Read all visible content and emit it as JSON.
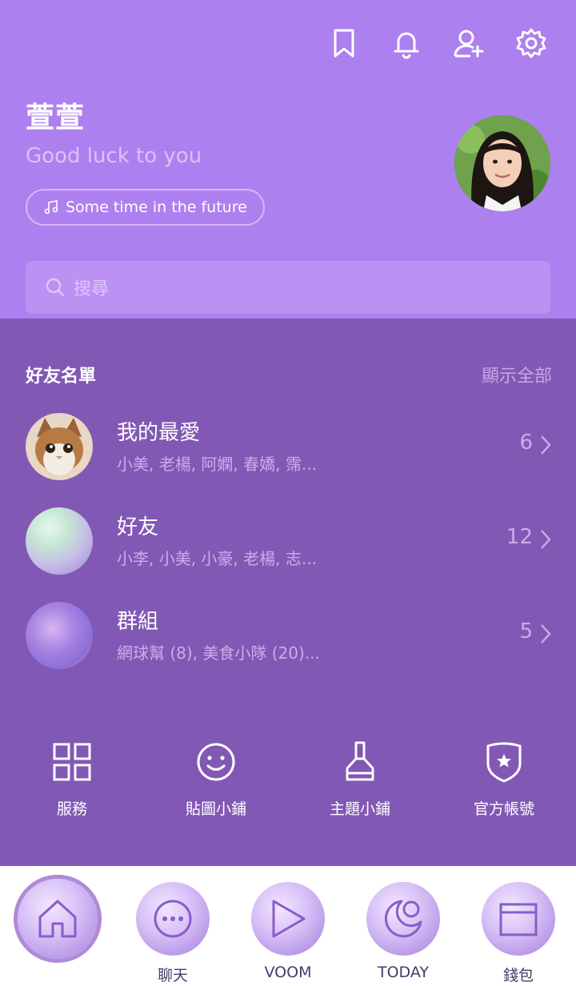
{
  "header": {
    "name": "萱萱",
    "status_message": "Good luck to you",
    "music": "Some time in the future",
    "search_placeholder": "搜尋"
  },
  "friends": {
    "section_title": "好友名單",
    "show_all": "顯示全部",
    "rows": [
      {
        "title": "我的最愛",
        "subtitle": "小美, 老楊, 阿嫻, 春嬌, 霈...",
        "count": "6"
      },
      {
        "title": "好友",
        "subtitle": "小李, 小美, 小豪, 老楊, 志...",
        "count": "12"
      },
      {
        "title": "群組",
        "subtitle": "網球幫 (8), 美食小隊 (20)...",
        "count": "5"
      }
    ]
  },
  "shortcuts": [
    {
      "label": "服務",
      "icon": "grid-icon"
    },
    {
      "label": "貼圖小鋪",
      "icon": "smiley-icon"
    },
    {
      "label": "主題小鋪",
      "icon": "brush-icon"
    },
    {
      "label": "官方帳號",
      "icon": "shield-star-icon"
    }
  ],
  "tabs": [
    {
      "label": "",
      "icon": "home-icon",
      "active": true
    },
    {
      "label": "聊天",
      "icon": "chat-icon"
    },
    {
      "label": "VOOM",
      "icon": "play-icon"
    },
    {
      "label": "TODAY",
      "icon": "moon-icon"
    },
    {
      "label": "錢包",
      "icon": "wallet-icon"
    }
  ],
  "colors": {
    "header_bg": "#ad80ef",
    "body_bg": "#8258b5",
    "tab_icon": "#8a5cc8"
  }
}
